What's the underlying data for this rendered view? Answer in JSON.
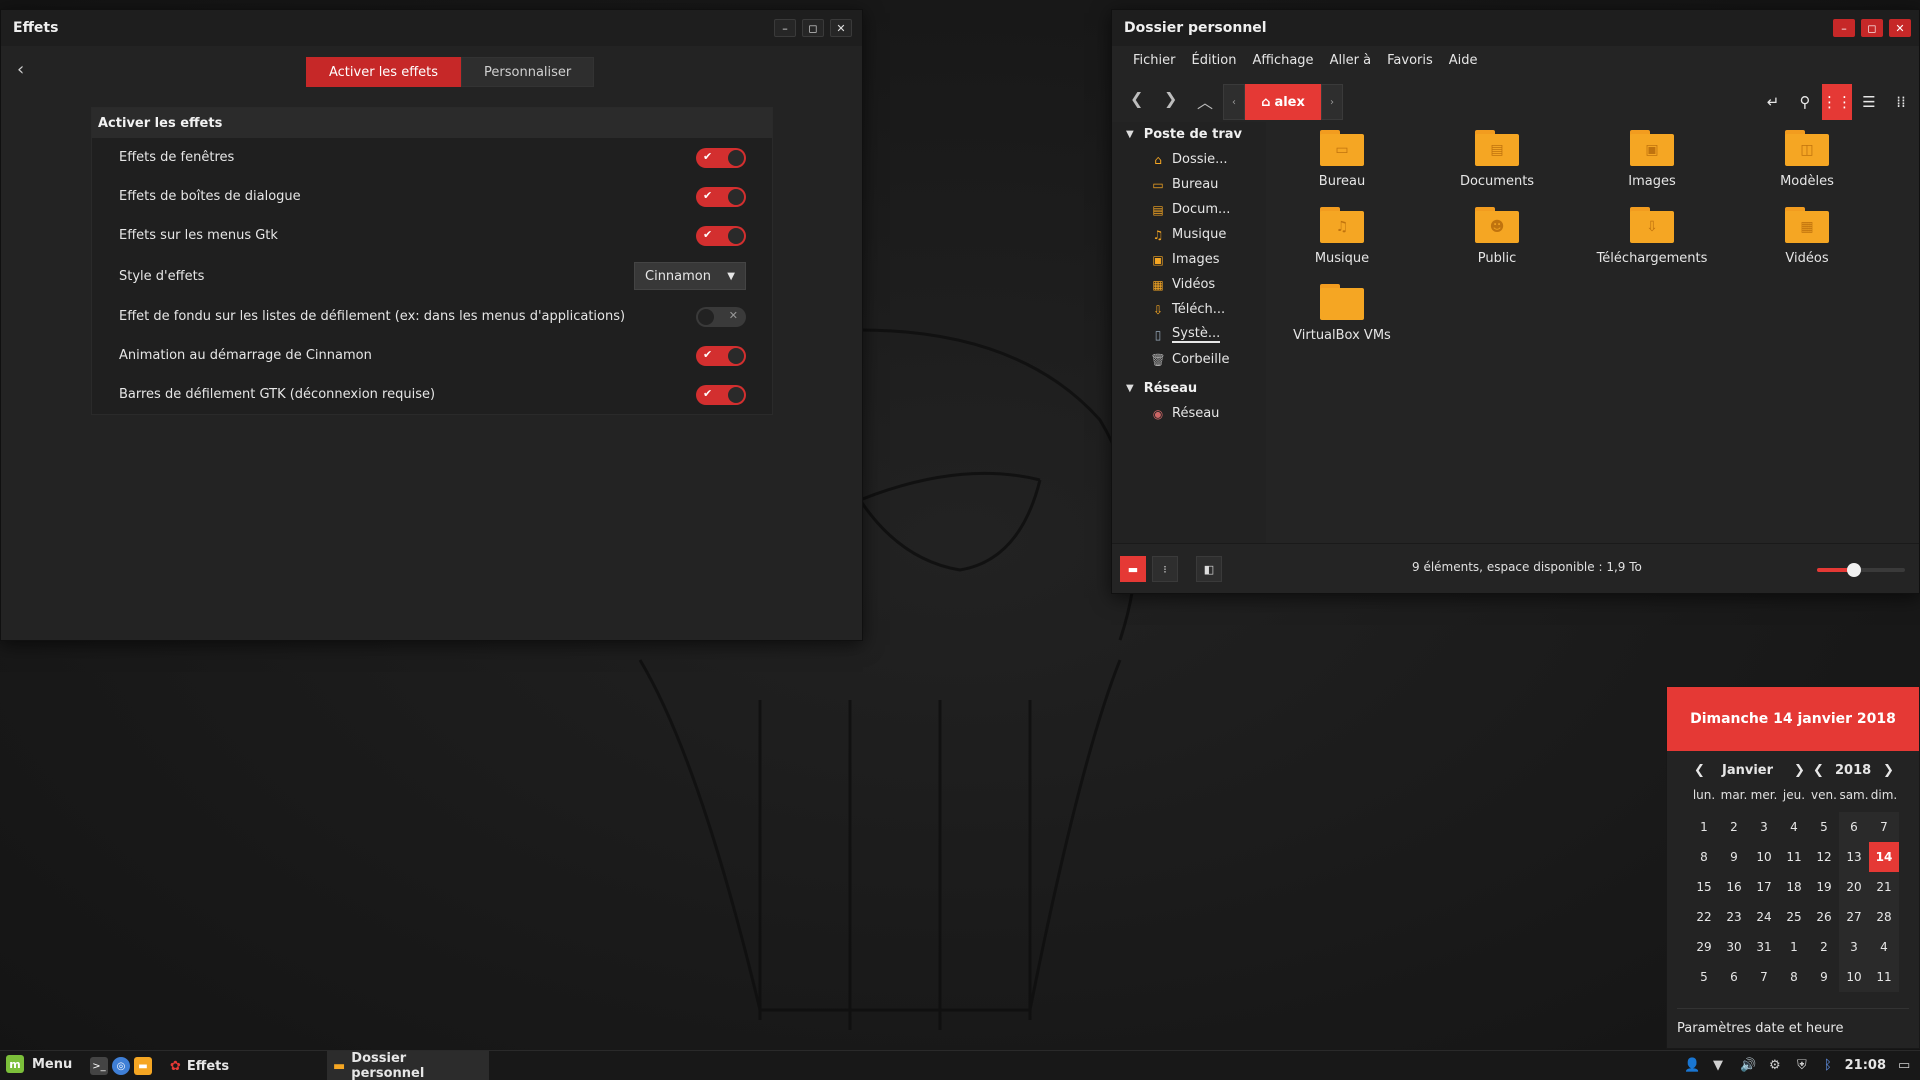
{
  "effets_window": {
    "title": "Effets",
    "tabs": [
      "Activer les effets",
      "Personnaliser"
    ],
    "section_title": "Activer les effets",
    "settings": [
      {
        "label": "Effets de fenêtres",
        "control": "toggle",
        "on": true
      },
      {
        "label": "Effets de boîtes de dialogue",
        "control": "toggle",
        "on": true
      },
      {
        "label": "Effets sur les menus Gtk",
        "control": "toggle",
        "on": true
      },
      {
        "label": "Style d'effets",
        "control": "dropdown",
        "value": "Cinnamon"
      },
      {
        "label": "Effet de fondu sur les listes de défilement (ex: dans les menus d'applications)",
        "control": "toggle",
        "on": false
      },
      {
        "label": "Animation au démarrage de Cinnamon",
        "control": "toggle",
        "on": true
      },
      {
        "label": "Barres de défilement GTK (déconnexion requise)",
        "control": "toggle",
        "on": true
      }
    ]
  },
  "nemo_window": {
    "title": "Dossier personnel",
    "menu": [
      "Fichier",
      "Édition",
      "Affichage",
      "Aller à",
      "Favoris",
      "Aide"
    ],
    "breadcrumb": "alex",
    "sidebar": {
      "group1": "Poste de trav",
      "group1_items": [
        {
          "label": "Dossie...",
          "icon": "home-icon"
        },
        {
          "label": "Bureau",
          "icon": "desktop-icon"
        },
        {
          "label": "Docum...",
          "icon": "document-icon"
        },
        {
          "label": "Musique",
          "icon": "music-icon"
        },
        {
          "label": "Images",
          "icon": "image-icon"
        },
        {
          "label": "Vidéos",
          "icon": "video-icon"
        },
        {
          "label": "Téléch...",
          "icon": "download-icon"
        },
        {
          "label": "Systè...",
          "icon": "drive-icon"
        },
        {
          "label": "Corbeille",
          "icon": "trash-icon"
        }
      ],
      "group2": "Réseau",
      "group2_items": [
        {
          "label": "Réseau",
          "icon": "network-icon"
        }
      ]
    },
    "files": [
      {
        "label": "Bureau",
        "glyph": "▭"
      },
      {
        "label": "Documents",
        "glyph": "▤"
      },
      {
        "label": "Images",
        "glyph": "▣"
      },
      {
        "label": "Modèles",
        "glyph": "◫"
      },
      {
        "label": "Musique",
        "glyph": "♫"
      },
      {
        "label": "Public",
        "glyph": "☻"
      },
      {
        "label": "Téléchargements",
        "glyph": "⇩"
      },
      {
        "label": "Vidéos",
        "glyph": "▦"
      },
      {
        "label": "VirtualBox VMs",
        "glyph": ""
      }
    ],
    "status": "9 éléments, espace disponible : 1,9 To",
    "zoom_level": 0.42
  },
  "calendar": {
    "header": "Dimanche 14 janvier 2018",
    "month": "Janvier",
    "year": "2018",
    "weekdays": [
      "lun.",
      "mar.",
      "mer.",
      "jeu.",
      "ven.",
      "sam.",
      "dim."
    ],
    "days": [
      "1",
      "2",
      "3",
      "4",
      "5",
      "6",
      "7",
      "8",
      "9",
      "10",
      "11",
      "12",
      "13",
      "14",
      "15",
      "16",
      "17",
      "18",
      "19",
      "20",
      "21",
      "22",
      "23",
      "24",
      "25",
      "26",
      "27",
      "28",
      "29",
      "30",
      "31",
      "1",
      "2",
      "3",
      "4",
      "5",
      "6",
      "7",
      "8",
      "9",
      "10",
      "11"
    ],
    "today": "14",
    "footer": "Paramètres date et heure"
  },
  "panel": {
    "menu_label": "Menu",
    "tasks": [
      "Effets",
      "Dossier personnel"
    ],
    "clock": "21:08"
  },
  "colors": {
    "accent": "#e53935",
    "folder": "#f5a623",
    "background": "#232323"
  }
}
